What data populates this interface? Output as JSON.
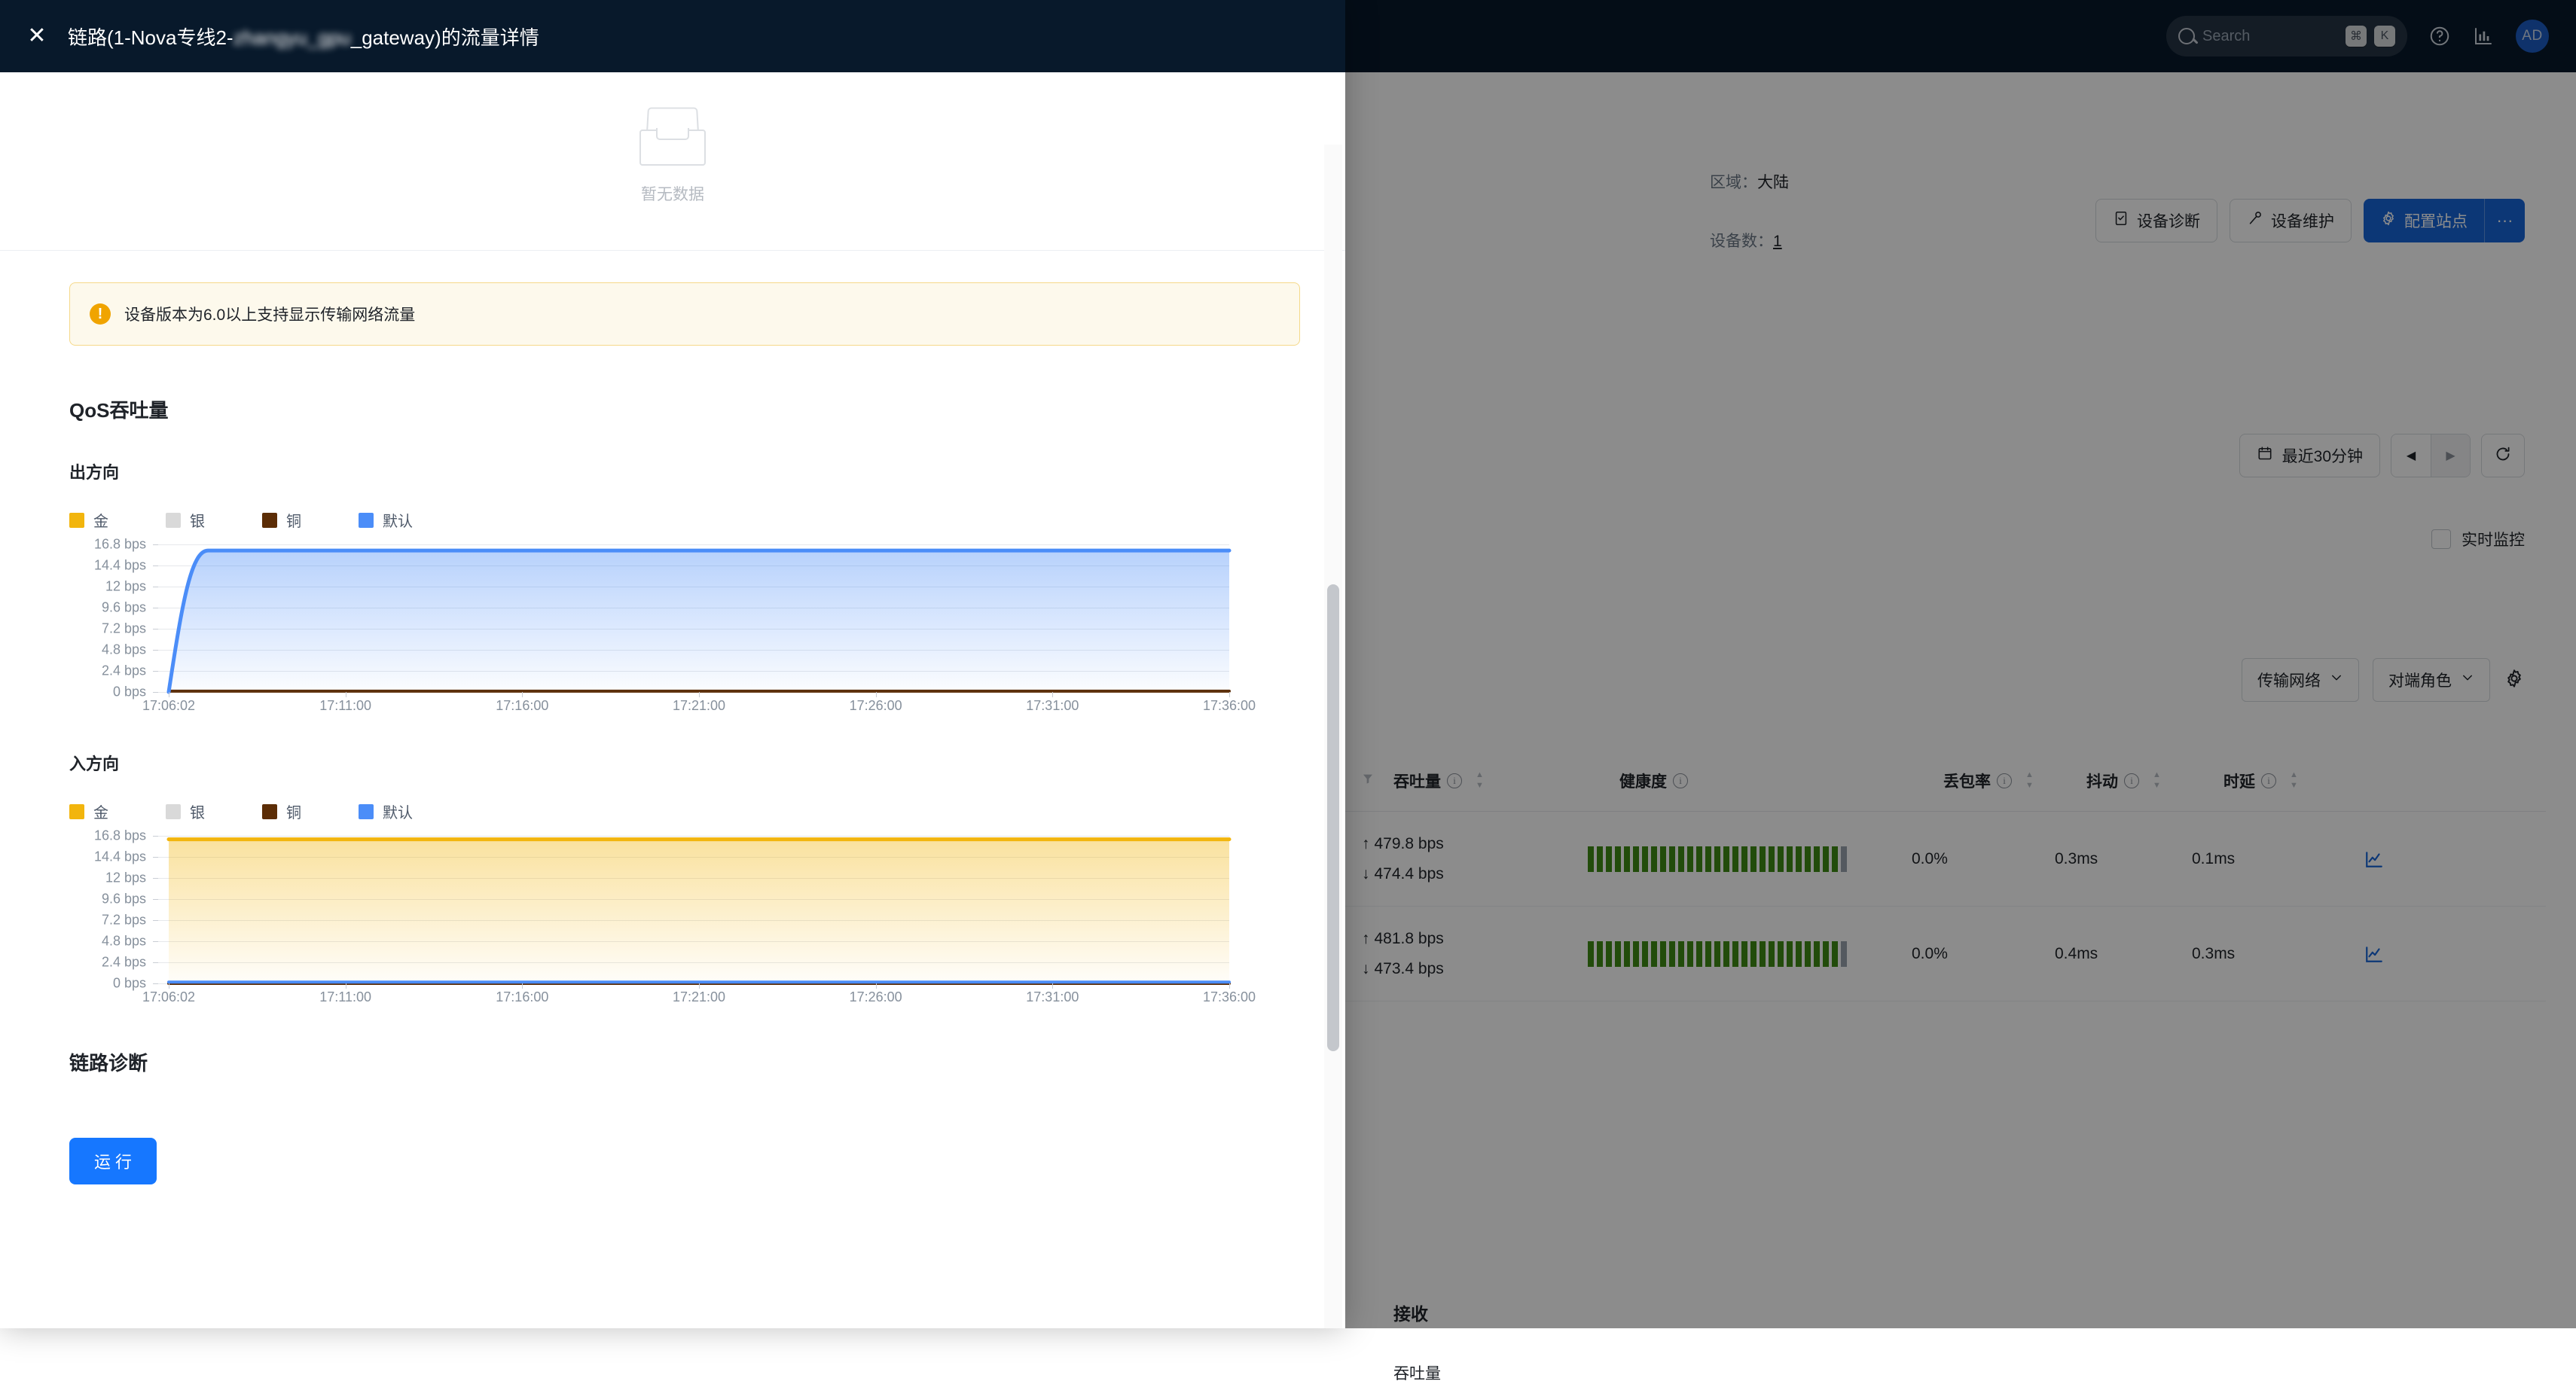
{
  "topnav": {
    "search_placeholder": "Search",
    "kbd_cmd": "⌘",
    "kbd_k": "K",
    "help_icon": "question-mark-circle-icon",
    "report_icon": "bar-chart-icon",
    "avatar_initials": "AD"
  },
  "background": {
    "buttons": {
      "diagnose": "设备诊断",
      "maintain": "设备维护",
      "configure_site": "配置站点",
      "more": "···"
    },
    "meta": {
      "region_label": "区域：",
      "region_value": "大陆",
      "device_count_label": "设备数：",
      "device_count_value": "1"
    },
    "timebar": {
      "range": "最近30分钟",
      "prev": "◀",
      "next": "▶",
      "refresh": "↻",
      "realtime_label": "实时监控"
    },
    "filters": {
      "transport_network": "传输网络",
      "peer_role": "对端角色",
      "settings_icon": "gear-icon"
    },
    "table": {
      "columns": [
        "吞吐量",
        "健康度",
        "丢包率",
        "抖动",
        "时延"
      ],
      "rows": [
        {
          "throughput_up": "479.8 bps",
          "throughput_down": "474.4 bps",
          "health_bars": 28,
          "health_dim": 1,
          "loss": "0.0%",
          "jitter": "0.3ms",
          "latency": "0.1ms"
        },
        {
          "throughput_up": "481.8 bps",
          "throughput_down": "473.4 bps",
          "health_bars": 28,
          "health_dim": 1,
          "loss": "0.0%",
          "jitter": "0.4ms",
          "latency": "0.3ms"
        }
      ]
    },
    "receive": {
      "title": "接收",
      "subtitle": "吞吐量"
    }
  },
  "drawer": {
    "close_icon": "close-icon",
    "title_prefix": "链路(1-Nova专线2-",
    "title_blurred": "zhangyu_gpu",
    "title_suffix": "_gateway)的流量详情",
    "empty_text": "暂无数据",
    "alert_text": "设备版本为6.0以上支持显示传输网络流量",
    "qos_title": "QoS吞吐量",
    "outbound_title": "出方向",
    "inbound_title": "入方向",
    "diag_title": "链路诊断",
    "run_button": "运行"
  },
  "colors": {
    "gold": "#f2b50d",
    "silver": "#d9d9d9",
    "bronze": "#5c2d06",
    "default_blue": "#4b8df8",
    "primary": "#1677ff",
    "header_bg": "#08192b",
    "health_green": "#3f8a14",
    "warning": "#f0a400"
  },
  "chart_data": [
    {
      "type": "area",
      "title": "出方向",
      "xlabel": "",
      "ylabel": "bps",
      "ylim": [
        0,
        16.8
      ],
      "grid": true,
      "legend_position": "top-left",
      "yticks": [
        "0 bps",
        "2.4 bps",
        "4.8 bps",
        "7.2 bps",
        "9.6 bps",
        "12 bps",
        "14.4 bps",
        "16.8 bps"
      ],
      "ytick_values": [
        0,
        2.4,
        4.8,
        7.2,
        9.6,
        12,
        14.4,
        16.8
      ],
      "x": [
        "17:06:02",
        "17:11:00",
        "17:16:00",
        "17:21:00",
        "17:26:00",
        "17:31:00",
        "17:36:00"
      ],
      "series": [
        {
          "name": "金",
          "color": "#f2b50d",
          "values": [
            0,
            0,
            0,
            0,
            0,
            0,
            0
          ]
        },
        {
          "name": "银",
          "color": "#d9d9d9",
          "values": [
            0,
            0,
            0,
            0,
            0,
            0,
            0
          ]
        },
        {
          "name": "铜",
          "color": "#5c2d06",
          "values": [
            0.1,
            0.1,
            0.1,
            0.1,
            0.1,
            0.1,
            0.1
          ]
        },
        {
          "name": "默认",
          "color": "#4b8df8",
          "values": [
            0,
            16.1,
            16.1,
            16.1,
            16.1,
            16.1,
            16.1
          ]
        }
      ]
    },
    {
      "type": "area",
      "title": "入方向",
      "xlabel": "",
      "ylabel": "bps",
      "ylim": [
        0,
        16.8
      ],
      "grid": true,
      "legend_position": "top-left",
      "yticks": [
        "0 bps",
        "2.4 bps",
        "4.8 bps",
        "7.2 bps",
        "9.6 bps",
        "12 bps",
        "14.4 bps",
        "16.8 bps"
      ],
      "ytick_values": [
        0,
        2.4,
        4.8,
        7.2,
        9.6,
        12,
        14.4,
        16.8
      ],
      "x": [
        "17:06:02",
        "17:11:00",
        "17:16:00",
        "17:21:00",
        "17:26:00",
        "17:31:00",
        "17:36:00"
      ],
      "series": [
        {
          "name": "金",
          "color": "#f2b50d",
          "values": [
            16.4,
            16.4,
            16.4,
            16.4,
            16.4,
            16.4,
            16.4
          ]
        },
        {
          "name": "银",
          "color": "#d9d9d9",
          "values": [
            0,
            0,
            0,
            0,
            0,
            0,
            0
          ]
        },
        {
          "name": "铜",
          "color": "#5c2d06",
          "values": [
            0,
            0,
            0,
            0,
            0,
            0,
            0
          ]
        },
        {
          "name": "默认",
          "color": "#4b8df8",
          "values": [
            0.15,
            0.15,
            0.15,
            0.15,
            0.15,
            0.15,
            0.15
          ]
        }
      ]
    }
  ]
}
